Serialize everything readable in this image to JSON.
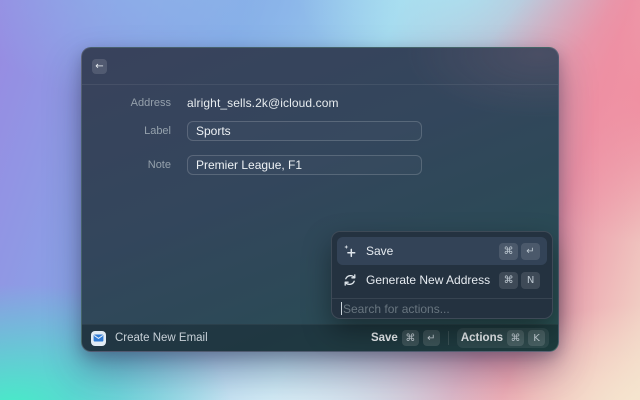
{
  "icons": {
    "back_arrow": "←"
  },
  "colors": {
    "window_bg_top": "#39425c",
    "window_bg_bottom": "#285150",
    "popup_bg": "#243240",
    "selected_row": "#33455c",
    "email_icon_blue": "#2f7ad4"
  },
  "form": {
    "address_label": "Address",
    "address_value": "alright_sells.2k@icloud.com",
    "label_label": "Label",
    "label_value": "Sports",
    "note_label": "Note",
    "note_value": "Premier League, F1"
  },
  "actions_popup": {
    "items": [
      {
        "icon": "sparkle-plus-icon",
        "label": "Save",
        "keys": [
          "⌘",
          "↵"
        ],
        "selected": true
      },
      {
        "icon": "refresh-icon",
        "label": "Generate New Address",
        "keys": [
          "⌘",
          "N"
        ],
        "selected": false
      }
    ],
    "search_placeholder": "Search for actions..."
  },
  "footer": {
    "app_icon": "email-icon",
    "context_label": "Create New Email",
    "save_label": "Save",
    "save_keys": [
      "⌘",
      "↵"
    ],
    "actions_label": "Actions",
    "actions_keys": [
      "⌘",
      "K"
    ]
  }
}
